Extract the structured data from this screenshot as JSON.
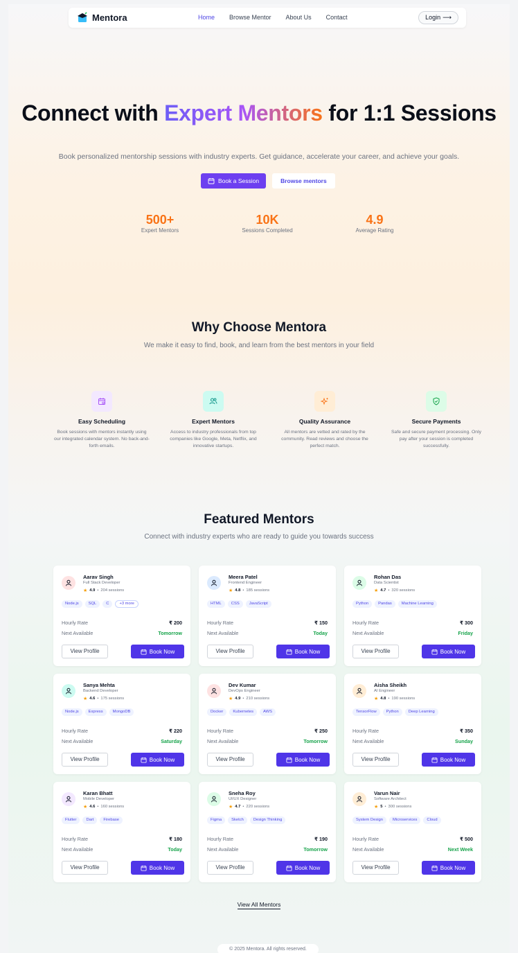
{
  "nav": {
    "brand": "Mentora",
    "links": [
      "Home",
      "Browse Mentor",
      "About Us",
      "Contact"
    ],
    "login": "Login",
    "login_arrow": "⟶"
  },
  "hero": {
    "title_pre": "Connect with ",
    "title_highlight": "Expert Mentors",
    "title_post": " for 1:1 Sessions",
    "subtitle": "Book personalized mentorship sessions with industry experts. Get guidance, accelerate your career, and achieve your goals.",
    "btn_book": "Book a Session",
    "btn_browse": "Browse mentors",
    "stats": [
      {
        "value": "500+",
        "label": "Expert Mentors"
      },
      {
        "value": "10K",
        "label": "Sessions Completed"
      },
      {
        "value": "4.9",
        "label": "Average Rating"
      }
    ]
  },
  "why": {
    "title": "Why Choose Mentora",
    "subtitle": "We make it easy to find, book, and learn from the best mentors in your field",
    "features": [
      {
        "title": "Easy Scheduling",
        "desc": "Book sessions with mentors instantly using our integrated calendar system. No back-and-forth emails.",
        "icon": "calendar-icon",
        "color": "#a855f7",
        "bg": "#f3e8ff"
      },
      {
        "title": "Expert Mentors",
        "desc": "Access to industry professionals from top companies like Google, Meta, Netflix, and innovative startups.",
        "icon": "users-icon",
        "color": "#0d9488",
        "bg": "#ccfbf1"
      },
      {
        "title": "Quality Assurance",
        "desc": "All mentors are vetted and rated by the community. Read reviews and choose the perfect match.",
        "icon": "sparkle-icon",
        "color": "#f97316",
        "bg": "#ffedd5"
      },
      {
        "title": "Secure Payments",
        "desc": "Safe and secure payment processing. Only pay after your session is completed successfully.",
        "icon": "shield-check-icon",
        "color": "#16a34a",
        "bg": "#dcfce7"
      }
    ]
  },
  "featured": {
    "title": "Featured Mentors",
    "subtitle": "Connect with industry experts who are ready to guide you towards success",
    "hourly_label": "Hourly Rate",
    "next_label": "Next Available",
    "view_label": "View Profile",
    "book_label": "Book Now",
    "mentors": [
      {
        "name": "Aarav Singh",
        "role": "Full Stack Developer",
        "rating": "4.9",
        "sessions": "204 sessions",
        "tags": [
          "Node.js",
          "SQL",
          "C"
        ],
        "more": "+3 more",
        "rate": "₹ 200",
        "next": "Tomorrow",
        "avatar_bg": "#fee2e2",
        "avatar_color": "#111827"
      },
      {
        "name": "Meera Patel",
        "role": "Frontend Engineer",
        "rating": "4.8",
        "sessions": "185 sessions",
        "tags": [
          "HTML",
          "CSS",
          "JavaScript"
        ],
        "more": "",
        "rate": "₹ 150",
        "next": "Today",
        "avatar_bg": "#dbeafe",
        "avatar_color": "#111827"
      },
      {
        "name": "Rohan Das",
        "role": "Data Scientist",
        "rating": "4.7",
        "sessions": "320 sessions",
        "tags": [
          "Python",
          "Pandas",
          "Machine Learning"
        ],
        "more": "",
        "rate": "₹ 300",
        "next": "Friday",
        "avatar_bg": "#dcfce7",
        "avatar_color": "#111827"
      },
      {
        "name": "Sanya Mehta",
        "role": "Backend Developer",
        "rating": "4.6",
        "sessions": "175 sessions",
        "tags": [
          "Node.js",
          "Express",
          "MongoDB"
        ],
        "more": "",
        "rate": "₹ 220",
        "next": "Saturday",
        "avatar_bg": "#ccfbf1",
        "avatar_color": "#111827"
      },
      {
        "name": "Dev Kumar",
        "role": "DevOps Engineer",
        "rating": "4.9",
        "sessions": "210 sessions",
        "tags": [
          "Docker",
          "Kubernetes",
          "AWS"
        ],
        "more": "",
        "rate": "₹ 250",
        "next": "Tomorrow",
        "avatar_bg": "#fee2e2",
        "avatar_color": "#111827"
      },
      {
        "name": "Aisha Sheikh",
        "role": "AI Engineer",
        "rating": "4.8",
        "sessions": "190 sessions",
        "tags": [
          "TensorFlow",
          "Python",
          "Deep Learning"
        ],
        "more": "",
        "rate": "₹ 350",
        "next": "Sunday",
        "avatar_bg": "#ffedd5",
        "avatar_color": "#111827"
      },
      {
        "name": "Karan Bhatt",
        "role": "Mobile Developer",
        "rating": "4.6",
        "sessions": "160 sessions",
        "tags": [
          "Flutter",
          "Dart",
          "Firebase"
        ],
        "more": "",
        "rate": "₹ 180",
        "next": "Today",
        "avatar_bg": "#f3e8ff",
        "avatar_color": "#111827"
      },
      {
        "name": "Sneha Roy",
        "role": "UI/UX Designer",
        "rating": "4.7",
        "sessions": "220 sessions",
        "tags": [
          "Figma",
          "Sketch",
          "Design Thinking"
        ],
        "more": "",
        "rate": "₹ 190",
        "next": "Tomorrow",
        "avatar_bg": "#dcfce7",
        "avatar_color": "#111827"
      },
      {
        "name": "Varun Nair",
        "role": "Software Architect",
        "rating": "5",
        "sessions": "300 sessions",
        "tags": [
          "System Design",
          "Microservices",
          "Cloud"
        ],
        "more": "",
        "rate": "₹ 500",
        "next": "Next Week",
        "avatar_bg": "#ffedd5",
        "avatar_color": "#111827"
      }
    ],
    "view_all": "View All Mentors"
  },
  "footer": {
    "text": "© 2025 Mentora. All rights reserved."
  }
}
